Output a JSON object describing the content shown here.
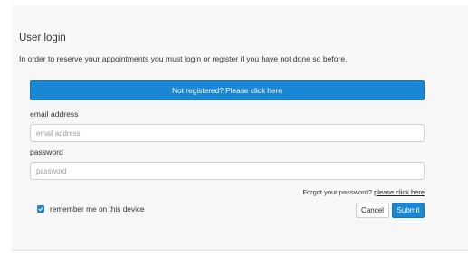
{
  "login": {
    "title": "User login",
    "intro": "In order to reserve your appointments you must login or register if you have not done so before.",
    "register_button": "Not registered? Please click here",
    "email_label": "email address",
    "email_placeholder": "email address",
    "email_value": "",
    "password_label": "password",
    "password_placeholder": "password",
    "password_value": "",
    "forgot_text": "Forgot your password?",
    "forgot_link": "please click here",
    "remember_label": "remember me on this device",
    "remember_checked": true,
    "cancel_button": "Cancel",
    "submit_button": "Submit"
  },
  "colors": {
    "accent": "#1a87d6",
    "panel_background": "#f7f7f7"
  },
  "icons": {
    "remember_checkbox": "checkmark-icon"
  }
}
